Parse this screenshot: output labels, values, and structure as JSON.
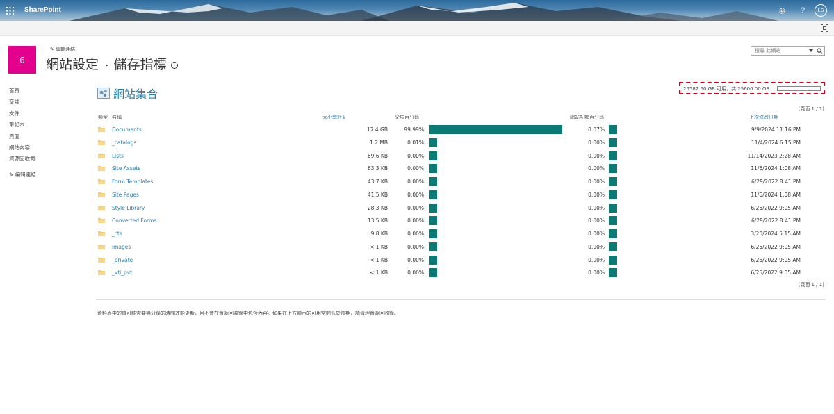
{
  "suite": {
    "brand": "SharePoint",
    "user_initials": "LS"
  },
  "site": {
    "logo_text": "6",
    "edit_links_label": "編輯連結",
    "breadcrumb_parent": "網站設定",
    "breadcrumb_current": "儲存指標",
    "info_glyph": "i",
    "accent_color": "#e3008c"
  },
  "search": {
    "placeholder": "搜尋 此網站"
  },
  "leftnav": {
    "items": [
      "首頁",
      "交談",
      "文件",
      "筆記本",
      "頁面",
      "網站內容",
      "資源回收筒"
    ],
    "edit_label": "編輯連結"
  },
  "collection": {
    "title": "網站集合",
    "storage_text": "25582.60 GB 可用，共 25600.00 GB",
    "storage_used_fraction": 0.0007,
    "pager_text": "(頁面 1 / 1)"
  },
  "table": {
    "headers": {
      "type": "類型",
      "name": "名稱",
      "size": "大小總計↓",
      "parent_pct": "父項百分比",
      "quota_pct": "網站配額百分比",
      "modified": "上次修改日期"
    },
    "bar_color": "#0b7a75",
    "rows": [
      {
        "name": "Documents",
        "size": "17.4 GB",
        "parent_pct": "99.99%",
        "parent_frac": 0.9999,
        "quota_pct": "0.07%",
        "modified": "9/9/2024 11:16 PM"
      },
      {
        "name": "_catalogs",
        "size": "1.2 MB",
        "parent_pct": "0.01%",
        "parent_frac": 0.0001,
        "quota_pct": "0.00%",
        "modified": "11/4/2024 6:15 PM"
      },
      {
        "name": "Lists",
        "size": "69.6 KB",
        "parent_pct": "0.00%",
        "parent_frac": 0,
        "quota_pct": "0.00%",
        "modified": "11/14/2023 2:28 AM"
      },
      {
        "name": "Site Assets",
        "size": "63.3 KB",
        "parent_pct": "0.00%",
        "parent_frac": 0,
        "quota_pct": "0.00%",
        "modified": "11/6/2024 1:08 AM"
      },
      {
        "name": "Form Templates",
        "size": "43.7 KB",
        "parent_pct": "0.00%",
        "parent_frac": 0,
        "quota_pct": "0.00%",
        "modified": "6/29/2022 8:41 PM"
      },
      {
        "name": "Site Pages",
        "size": "41.5 KB",
        "parent_pct": "0.00%",
        "parent_frac": 0,
        "quota_pct": "0.00%",
        "modified": "11/6/2024 1:08 AM"
      },
      {
        "name": "Style Library",
        "size": "28.3 KB",
        "parent_pct": "0.00%",
        "parent_frac": 0,
        "quota_pct": "0.00%",
        "modified": "6/25/2022 9:05 AM"
      },
      {
        "name": "Converted Forms",
        "size": "13.5 KB",
        "parent_pct": "0.00%",
        "parent_frac": 0,
        "quota_pct": "0.00%",
        "modified": "6/29/2022 8:41 PM"
      },
      {
        "name": "_cts",
        "size": "9.8 KB",
        "parent_pct": "0.00%",
        "parent_frac": 0,
        "quota_pct": "0.00%",
        "modified": "3/20/2024 5:15 AM"
      },
      {
        "name": "images",
        "size": "< 1 KB",
        "parent_pct": "0.00%",
        "parent_frac": 0,
        "quota_pct": "0.00%",
        "modified": "6/25/2022 9:05 AM"
      },
      {
        "name": "_private",
        "size": "< 1 KB",
        "parent_pct": "0.00%",
        "parent_frac": 0,
        "quota_pct": "0.00%",
        "modified": "6/25/2022 9:05 AM"
      },
      {
        "name": "_vti_pvt",
        "size": "< 1 KB",
        "parent_pct": "0.00%",
        "parent_frac": 0,
        "quota_pct": "0.00%",
        "modified": "6/25/2022 9:05 AM"
      }
    ]
  },
  "footnote": "資料表中的值可能需要幾分鐘的時間才能更新，且不會在資源回收筒中包含內容。如果在上方顯示的可用空間低於預期，請清理資源回收筒。",
  "icons": {
    "waffle": "app-launcher-icon",
    "settings": "gear-icon",
    "help": "help-icon",
    "focus": "focus-mode-icon",
    "search": "search-icon",
    "edit": "pencil-icon",
    "folder": "folder-icon"
  }
}
